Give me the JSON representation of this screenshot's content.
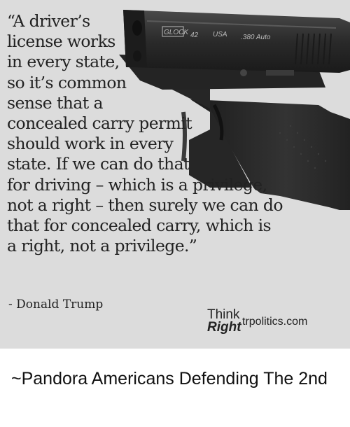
{
  "meme": {
    "quote": "“A driver’s\nlicense works\nin every state,\nso it’s common\nsense that a\nconcealed carry permit\nshould work in every\nstate. If we can do that\nfor driving – which is a privilege,\nnot a right – then surely we can do\nthat for concealed carry, which is\na right, not a privilege.”",
    "attribution": "- Donald Trump",
    "logo_think": "Think",
    "logo_right": "Right",
    "site": "trpolitics.com",
    "engraving_brand": "GLOCK",
    "engraving_model": "42",
    "engraving_country": "USA",
    "engraving_caliber": ".380 Auto"
  },
  "caption": "~Pandora Americans Defending The 2nd",
  "colors": {
    "background": "#dcdcdc",
    "gun_body": "#2a2a2a",
    "text": "#222222"
  },
  "icons": [
    "handgun-image"
  ]
}
